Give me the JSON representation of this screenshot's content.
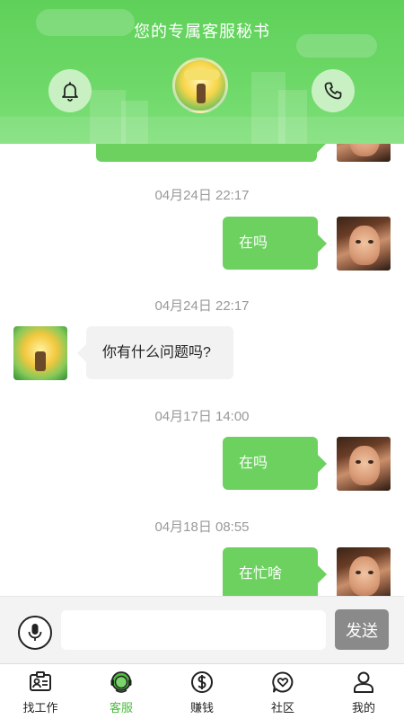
{
  "header": {
    "title": "您的专属客服秘书",
    "bell_icon": "bell-icon",
    "phone_icon": "phone-icon",
    "accent_color": "#6dd160"
  },
  "messages": [
    {
      "timestamp": "04月24日 22:17",
      "side": "right",
      "text": "在吗"
    },
    {
      "timestamp": "04月24日 22:17",
      "side": "left",
      "text": "你有什么问题吗?"
    },
    {
      "timestamp": "04月17日 14:00",
      "side": "right",
      "text": "在吗"
    },
    {
      "timestamp": "04月18日 08:55",
      "side": "right",
      "text": "在忙啥"
    }
  ],
  "input_bar": {
    "mic_icon": "microphone-icon",
    "input_value": "",
    "input_placeholder": "",
    "send_label": "发送"
  },
  "tabs": [
    {
      "label": "找工作",
      "icon": "id-card-icon",
      "active": false
    },
    {
      "label": "客服",
      "icon": "customer-service-icon",
      "active": true
    },
    {
      "label": "赚钱",
      "icon": "dollar-icon",
      "active": false
    },
    {
      "label": "社区",
      "icon": "community-heart-icon",
      "active": false
    },
    {
      "label": "我的",
      "icon": "user-icon",
      "active": false
    }
  ],
  "colors": {
    "active_tab": "#4cbb3f",
    "send_button": "#8a8a8a",
    "timestamp": "#999999"
  }
}
